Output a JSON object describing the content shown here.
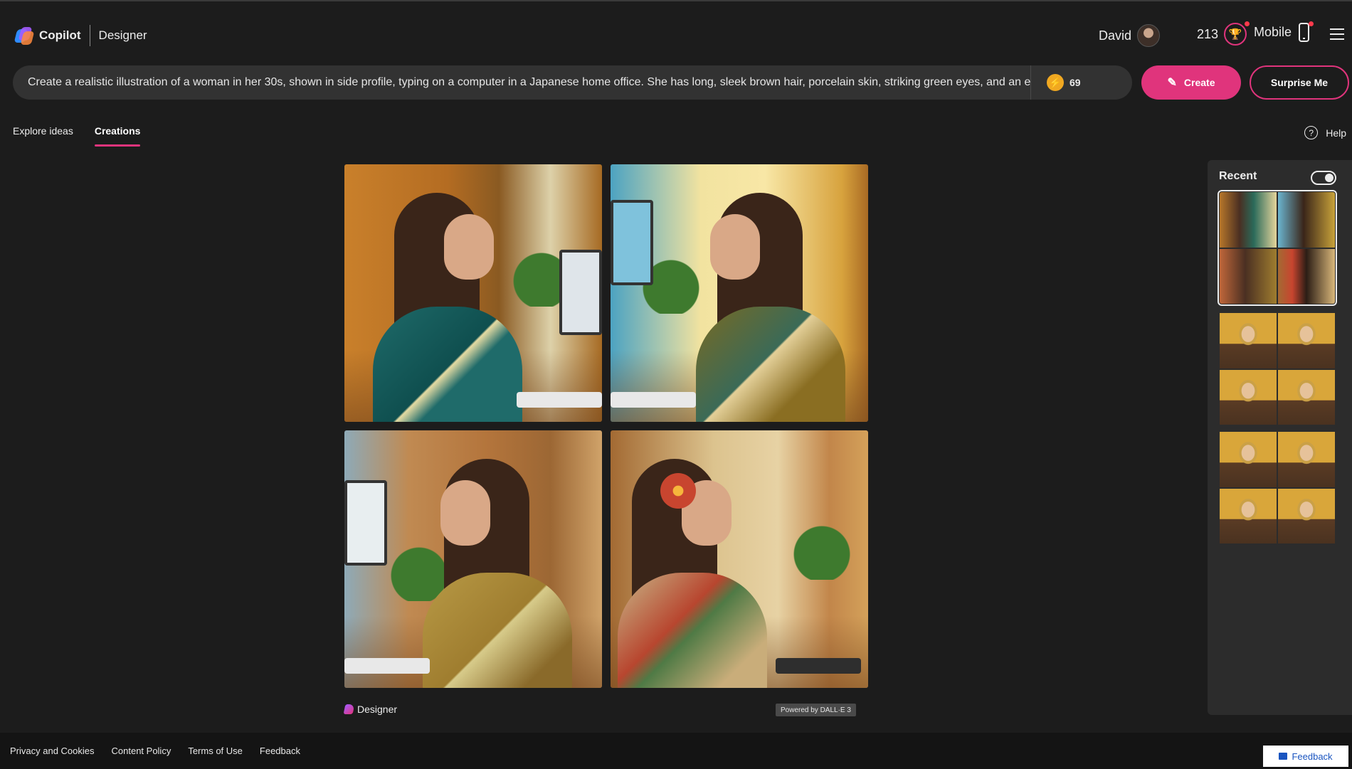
{
  "header": {
    "brand": "Copilot",
    "product": "Designer",
    "user_name": "David",
    "points": "213",
    "mobile_label": "Mobile"
  },
  "prompt": {
    "text": "Create a realistic illustration of a woman in her 30s, shown in side profile, typing on a computer in a Japanese home office. She has long, sleek brown hair, porcelain skin, striking green eyes, and an e",
    "boosts": "69",
    "create_label": "Create",
    "surprise_label": "Surprise Me"
  },
  "tabs": [
    {
      "label": "Explore ideas",
      "active": false
    },
    {
      "label": "Creations",
      "active": true
    }
  ],
  "help_label": "Help",
  "results": {
    "images": [
      {
        "name": "generated-image-1"
      },
      {
        "name": "generated-image-2"
      },
      {
        "name": "generated-image-3"
      },
      {
        "name": "generated-image-4"
      }
    ],
    "designer_label": "Designer",
    "badge": "Powered by DALL·E 3"
  },
  "recent": {
    "title": "Recent",
    "toggle_on": true,
    "sets": 3
  },
  "footer": {
    "links": [
      "Privacy and Cookies",
      "Content Policy",
      "Terms of Use",
      "Feedback"
    ],
    "feedback_button": "Feedback"
  },
  "colors": {
    "background": "#1c1c1c",
    "accent": "#e0347c",
    "surface": "#323232",
    "panel": "#2c2c2c"
  }
}
